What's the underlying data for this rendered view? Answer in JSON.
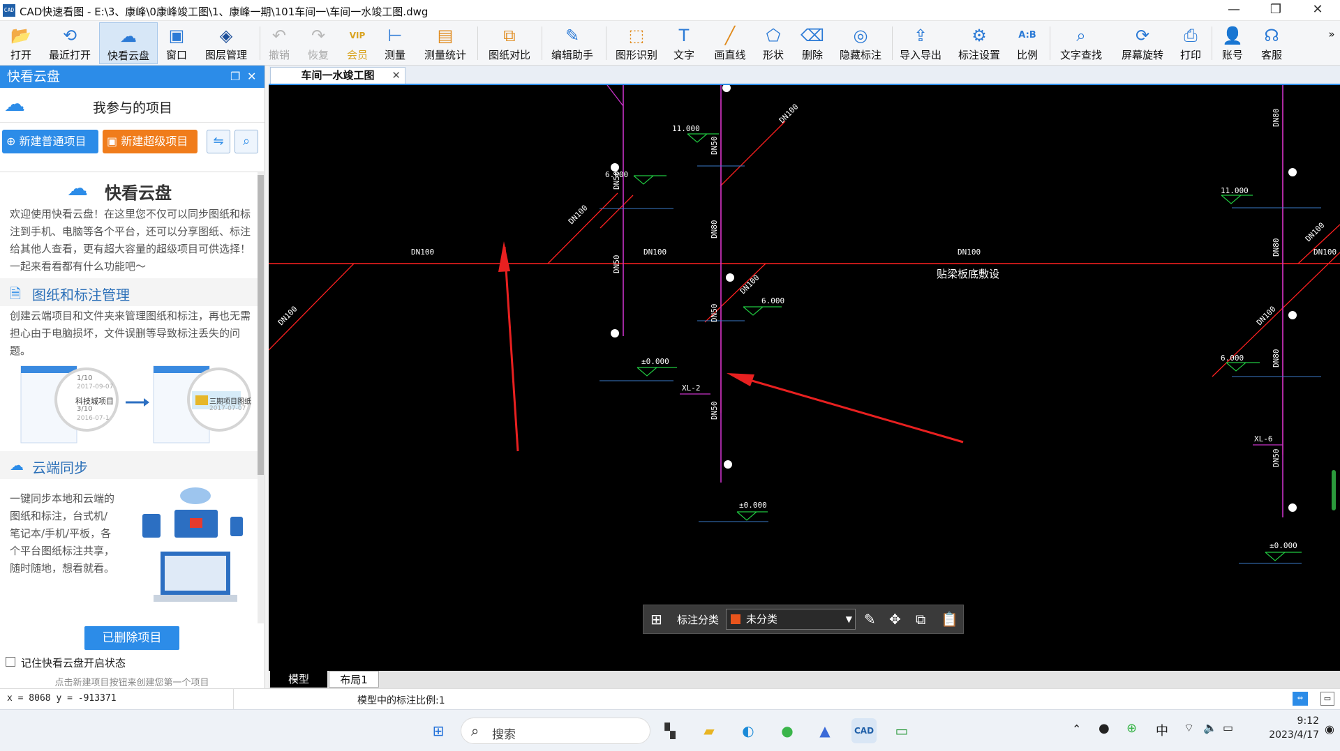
{
  "window": {
    "title": "CAD快速看图 - E:\\3、康峰\\0康峰竣工图\\1、康峰一期\\101车间一\\车间一水竣工图.dwg",
    "app_icon": "CAD",
    "controls": {
      "minimize": "—",
      "restore": "❐",
      "close": "✕"
    }
  },
  "toolbar": {
    "items": [
      {
        "label": "打开",
        "icon": "folder-icon",
        "glyph": "📂"
      },
      {
        "label": "最近打开",
        "icon": "history-icon",
        "glyph": "⟲"
      },
      {
        "label": "快看云盘",
        "icon": "cloud-icon",
        "glyph": "☁"
      },
      {
        "label": "窗口",
        "icon": "window-icon",
        "glyph": "▣"
      },
      {
        "label": "图层管理",
        "icon": "layers-icon",
        "glyph": "◈"
      },
      {
        "label": "撤销",
        "icon": "undo-icon",
        "glyph": "↶"
      },
      {
        "label": "恢复",
        "icon": "redo-icon",
        "glyph": "↷"
      },
      {
        "label": "会员",
        "icon": "vip-icon",
        "glyph": "VIP"
      },
      {
        "label": "测量",
        "icon": "ruler-icon",
        "glyph": "⊢"
      },
      {
        "label": "测量统计",
        "icon": "measure-stats-icon",
        "glyph": "▤"
      },
      {
        "label": "图纸对比",
        "icon": "compare-icon",
        "glyph": "⧉"
      },
      {
        "label": "编辑助手",
        "icon": "edit-assistant-icon",
        "glyph": "✎"
      },
      {
        "label": "图形识别",
        "icon": "shape-recognition-icon",
        "glyph": "⬚"
      },
      {
        "label": "文字",
        "icon": "text-icon",
        "glyph": "T"
      },
      {
        "label": "画直线",
        "icon": "line-icon",
        "glyph": "╱"
      },
      {
        "label": "形状",
        "icon": "shape-icon",
        "glyph": "⬠"
      },
      {
        "label": "删除",
        "icon": "eraser-icon",
        "glyph": "⌫"
      },
      {
        "label": "隐藏标注",
        "icon": "hide-annotation-icon",
        "glyph": "◎"
      },
      {
        "label": "导入导出",
        "icon": "import-export-icon",
        "glyph": "⇪"
      },
      {
        "label": "标注设置",
        "icon": "annotation-settings-icon",
        "glyph": "⚙"
      },
      {
        "label": "比例",
        "icon": "scale-icon",
        "glyph": "A:B"
      },
      {
        "label": "文字查找",
        "icon": "text-search-icon",
        "glyph": "⌕"
      },
      {
        "label": "屏幕旋转",
        "icon": "rotate-screen-icon",
        "glyph": "⟳"
      },
      {
        "label": "打印",
        "icon": "print-icon",
        "glyph": "⎙"
      },
      {
        "label": "账号",
        "icon": "account-icon",
        "glyph": "👤"
      },
      {
        "label": "客服",
        "icon": "headset-icon",
        "glyph": "☊"
      }
    ],
    "more": "»"
  },
  "left_panel": {
    "title": "快看云盘",
    "project_header": "我参与的项目",
    "new_normal_btn": "新建普通项目",
    "new_super_btn": "新建超级项目",
    "card_title": "快看云盘",
    "intro": "欢迎使用快看云盘！在这里您不仅可以同步图纸和标注到手机、电脑等各个平台，还可以分享图纸、标注给其他人查看，更有超大容量的超级项目可供选择！一起来看看都有什么功能吧～",
    "section1_title": "图纸和标注管理",
    "section1_text": "创建云端项目和文件夹来管理图纸和标注，再也无需担心由于电脑损坏，文件误删等导致标注丢失的问题。",
    "illus1": {
      "count1": "1/10",
      "date1": "2017-09-07",
      "name1": "科技城项目",
      "count2": "3/10",
      "date2": "2016-07-1",
      "name3": "三期项目图纸",
      "date3": "2017-07-07"
    },
    "section2_title": "云端同步",
    "section2_text": "一键同步本地和云端的图纸和标注，台式机/笔记本/手机/平板，各个平台图纸标注共享，随时随地，想看就看。",
    "deleted_btn": "已删除项目",
    "remember_label": "记住快看云盘开启状态",
    "hint": "点击新建项目按钮来创建您第一个项目"
  },
  "doc_tab": {
    "label": "车间一水竣工图",
    "close": "✕"
  },
  "cad": {
    "labels": {
      "dn100": "DN100",
      "dn50": "DN50",
      "dn80": "DN80",
      "el_11": "11.000",
      "el_6": "6.000",
      "el_0": "±0.000",
      "xl2": "XL-2",
      "xl6": "XL-6",
      "note": "贴梁板底敷设"
    }
  },
  "float_bar": {
    "label": "标注分类",
    "selected": "未分类",
    "swatch": "#e8541c"
  },
  "layout_tabs": [
    {
      "label": "模型"
    },
    {
      "label": "布局1"
    }
  ],
  "status": {
    "coords": "x = 8068  y = -913371",
    "scale": "模型中的标注比例:1"
  },
  "taskbar": {
    "search": "搜索",
    "ime": "中",
    "time": "9:12",
    "date": "2023/4/17"
  },
  "colors": {
    "accent": "#2c8ce8",
    "orange": "#f07c1b",
    "pipe_red": "#ff2020",
    "pipe_magenta": "#c832c8",
    "level_green": "#20c840",
    "arrow": "#e82020"
  }
}
